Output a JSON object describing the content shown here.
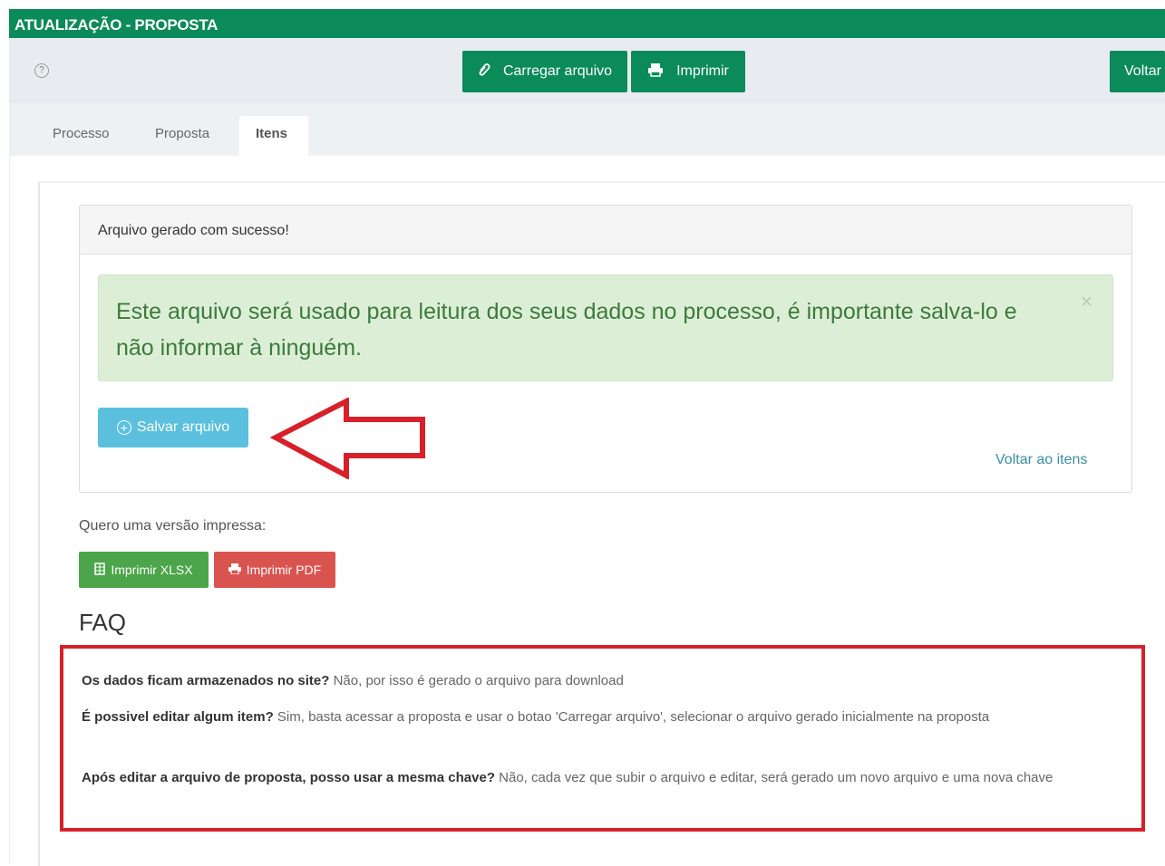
{
  "header": {
    "title": "ATUALIZAÇÃO - PROPOSTA"
  },
  "toolbar": {
    "help_icon": "question-circle-icon",
    "upload_label": "Carregar arquivo",
    "upload_icon": "paperclip-icon",
    "print_label": "Imprimir",
    "print_icon": "printer-icon",
    "back_label": "Voltar"
  },
  "tabs": [
    {
      "label": "Processo",
      "active": false
    },
    {
      "label": "Proposta",
      "active": false
    },
    {
      "label": "Itens",
      "active": true
    }
  ],
  "panel": {
    "heading": "Arquivo gerado com sucesso!",
    "alert_text": "Este arquivo será usado para leitura dos seus dados no processo, é importante salva-lo e não informar à ninguém.",
    "alert_close": "×",
    "save_label": "Salvar arquivo",
    "save_icon": "plus-circle-icon",
    "back_link": "Voltar ao itens"
  },
  "print_section": {
    "label": "Quero uma versão impressa:",
    "xlsx_label": "Imprimir XLSX",
    "pdf_label": "Imprimir PDF"
  },
  "faq": {
    "title": "FAQ",
    "items": [
      {
        "q": "Os dados ficam armazenados no site?",
        "a": "Não, por isso é gerado o arquivo para download"
      },
      {
        "q": "É possivel editar algum item?",
        "a": "Sim, basta acessar a proposta e usar o botao 'Carregar arquivo', selecionar o arquivo gerado inicialmente na proposta"
      },
      {
        "q": "Após editar a arquivo de proposta, posso usar a mesma chave?",
        "a": "Não, cada vez que subir o arquivo e editar, será gerado um novo arquivo e uma nova chave"
      }
    ]
  },
  "colors": {
    "brand_green": "#0b8a5a",
    "info_blue": "#5bc0de",
    "success_green": "#4ca54a",
    "danger_red": "#d9534f",
    "annotation_red": "#d8202a"
  }
}
